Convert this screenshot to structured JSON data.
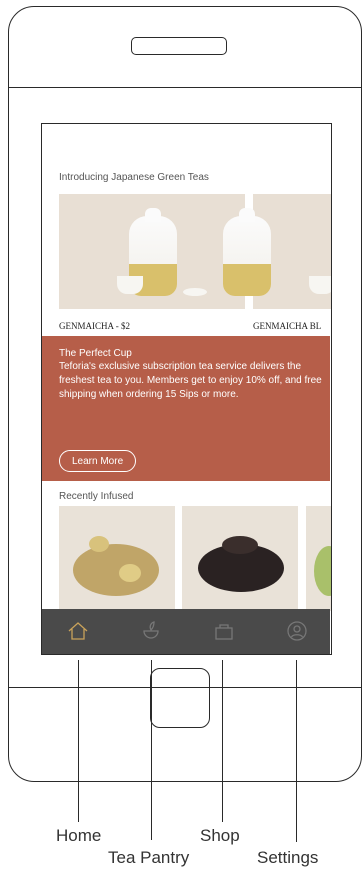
{
  "screen": {
    "intro_title": "Introducing Japanese Green Teas",
    "products": [
      {
        "label": "GENMAICHA - $2"
      },
      {
        "label": "GENMAICHA BL"
      }
    ],
    "promo": {
      "title": "The Perfect Cup",
      "body": "Teforia's exclusive subscription tea service delivers the freshest tea to you. Members get to enjoy 10% off, and free shipping when ordering 15 Sips or more.",
      "button_label": "Learn More",
      "color": "#b65e49"
    },
    "recent_title": "Recently Infused",
    "tabbar": {
      "items": [
        {
          "icon": "home-icon",
          "active": true
        },
        {
          "icon": "tea-pantry-icon",
          "active": false
        },
        {
          "icon": "shop-icon",
          "active": false
        },
        {
          "icon": "settings-icon",
          "active": false
        }
      ],
      "active_color": "#c9a25a",
      "inactive_color": "#777777"
    }
  },
  "callouts": {
    "home": "Home",
    "tea_pantry": "Tea Pantry",
    "shop": "Shop",
    "settings": "Settings"
  }
}
